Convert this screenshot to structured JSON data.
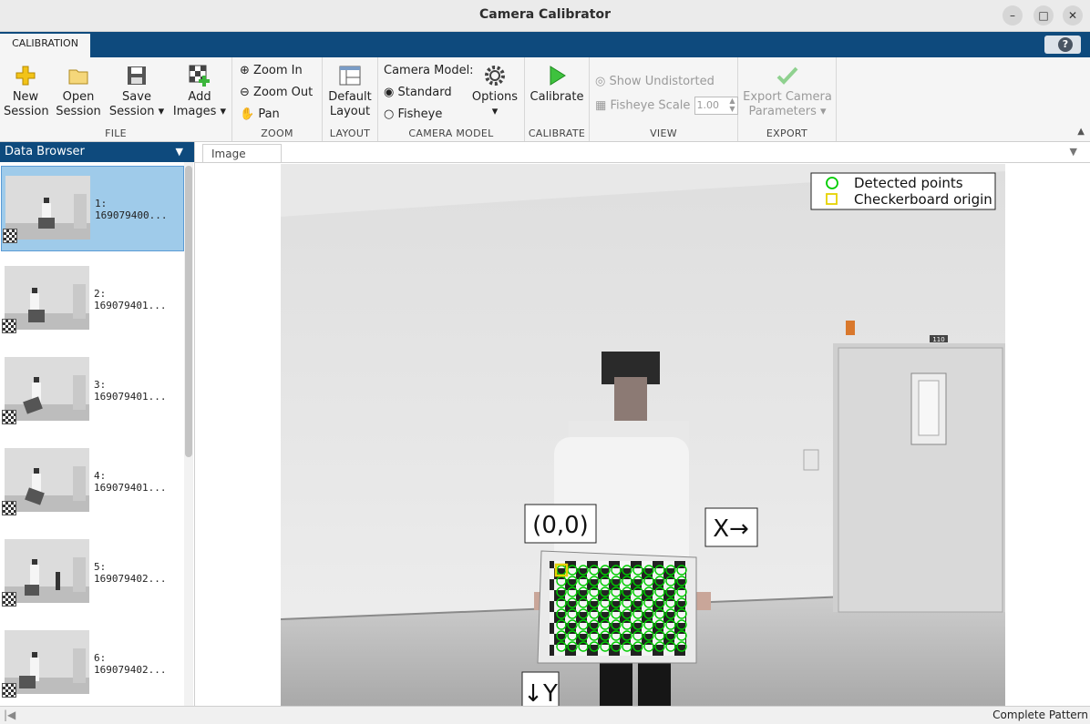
{
  "window": {
    "title": "Camera Calibrator"
  },
  "tabs": [
    {
      "label": "CALIBRATION"
    }
  ],
  "help": {
    "label": "?"
  },
  "toolstrip": {
    "file": {
      "label": "FILE",
      "new": [
        "New",
        "Session"
      ],
      "open": [
        "Open",
        "Session"
      ],
      "save": [
        "Save",
        "Session ▾"
      ],
      "add": [
        "Add",
        "Images ▾"
      ]
    },
    "zoom": {
      "label": "ZOOM",
      "zoom_in": "Zoom In",
      "zoom_out": "Zoom Out",
      "pan": "Pan"
    },
    "layout": {
      "label": "LAYOUT",
      "default": [
        "Default",
        "Layout"
      ]
    },
    "camera_model": {
      "label": "CAMERA MODEL",
      "title": "Camera Model:",
      "standard": "Standard",
      "fisheye": "Fisheye",
      "options": "Options"
    },
    "calibrate": {
      "label": "CALIBRATE",
      "button": "Calibrate"
    },
    "view": {
      "label": "VIEW",
      "show_undistorted": "Show Undistorted",
      "fisheye_scale": "Fisheye Scale",
      "fisheye_scale_value": "1.00"
    },
    "export": {
      "label": "EXPORT",
      "button": [
        "Export Camera",
        "Parameters ▾"
      ]
    }
  },
  "data_browser": {
    "title": "Data Browser",
    "items": [
      {
        "index": "1:",
        "name": "169079400..."
      },
      {
        "index": "2:",
        "name": "169079401..."
      },
      {
        "index": "3:",
        "name": "169079401..."
      },
      {
        "index": "4:",
        "name": "169079401..."
      },
      {
        "index": "5:",
        "name": "169079402..."
      },
      {
        "index": "6:",
        "name": "169079402..."
      }
    ],
    "selected_index": 0
  },
  "image_panel": {
    "tab": "Image",
    "legend": {
      "detected": "Detected points",
      "origin": "Checkerboard origin",
      "detected_color": "#00cc00",
      "origin_color": "#e6d200"
    },
    "annotations": {
      "origin": "(0,0)",
      "x_axis": "X→",
      "y_axis": "↓Y"
    },
    "door_sign": "110"
  },
  "status": {
    "text": "Complete Pattern"
  }
}
